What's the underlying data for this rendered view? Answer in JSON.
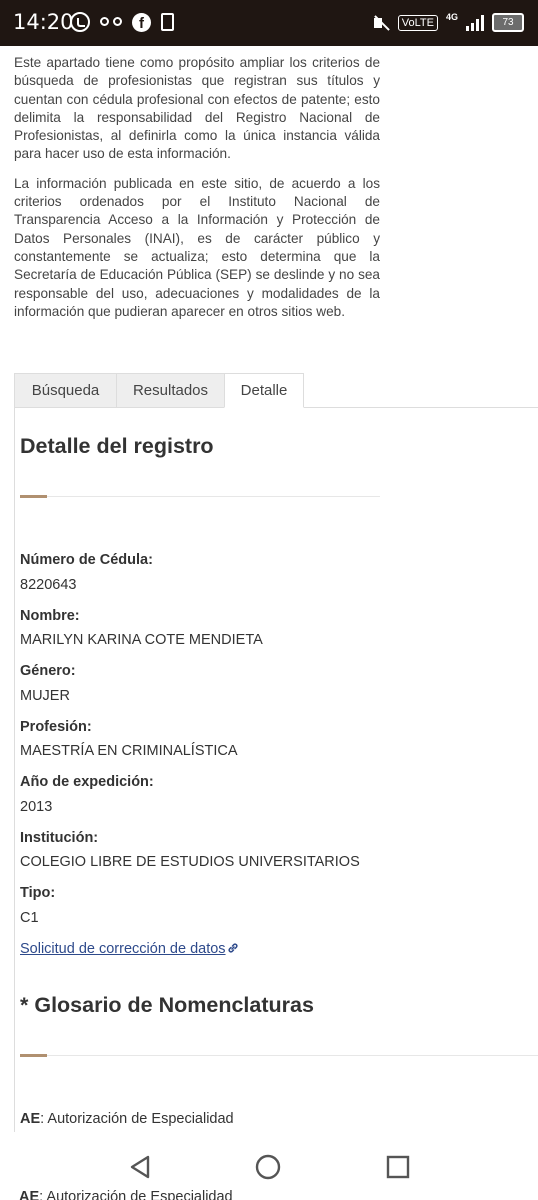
{
  "status_bar": {
    "time": "14:20",
    "left_icons": [
      "whatsapp-icon",
      "voicemail-icon",
      "facebook-icon",
      "sim-icon"
    ],
    "right_icons": [
      "mute-icon",
      "volte-icon",
      "signal-icon",
      "battery-icon"
    ],
    "volte": "VoLTE",
    "network": "4G",
    "battery": "73"
  },
  "intro": {
    "paragraph_1": "Este apartado tiene como propósito ampliar los criterios de búsqueda de profesionistas que registran sus títulos y cuentan con cédula profesional con efectos de patente; esto delimita la responsabilidad del Registro Nacional de Profesionistas, al definirla como la única instancia válida para hacer uso de esta información.",
    "paragraph_2": "La información publicada en este sitio, de acuerdo a los criterios ordenados por el Instituto Nacional de Transparencia  Acceso a la Información y Protección de Datos Personales (INAI), es de carácter público y constantemente se actualiza; esto determina que la Secretaría de Educación Pública (SEP) se deslinde y no sea responsable del uso, adecuaciones y modalidades de la información que pudieran aparecer en otros sitios web."
  },
  "tabs": [
    {
      "label": "Búsqueda",
      "active": false
    },
    {
      "label": "Resultados",
      "active": false
    },
    {
      "label": "Detalle",
      "active": true
    }
  ],
  "detail": {
    "title": "Detalle del registro",
    "fields": [
      {
        "label": "Número de Cédula:",
        "value": "8220643"
      },
      {
        "label": "Nombre:",
        "value": "MARILYN KARINA COTE MENDIETA"
      },
      {
        "label": "Género:",
        "value": "MUJER"
      },
      {
        "label": "Profesión:",
        "value": "MAESTRÍA EN CRIMINALÍSTICA"
      },
      {
        "label": "Año de expedición:",
        "value": "2013"
      },
      {
        "label": "Institución:",
        "value": "COLEGIO LIBRE DE ESTUDIOS UNIVERSITARIOS"
      },
      {
        "label": "Tipo:",
        "value": "C1"
      }
    ],
    "correction_link": "Solicitud de corrección de datos"
  },
  "glossary": {
    "title": "* Glosario de Nomenclaturas",
    "items": [
      {
        "code": "AE",
        "description": ": Autorización de Especialidad"
      }
    ]
  },
  "colors": {
    "status_bar": "#1f1612",
    "accent": "#b09070",
    "link": "#2e4a8b"
  },
  "nav_bar": [
    "back-icon",
    "home-icon",
    "recents-icon"
  ]
}
